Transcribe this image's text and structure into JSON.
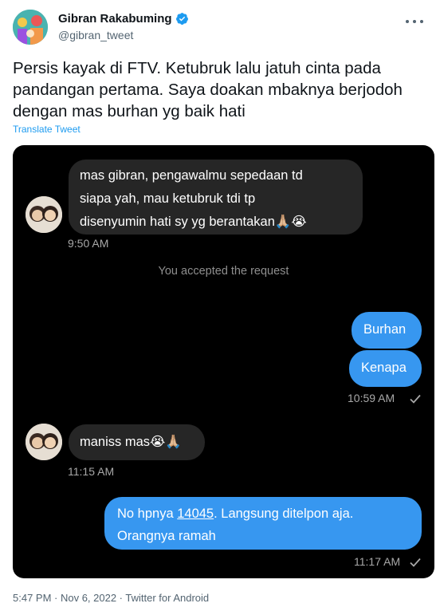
{
  "tweet": {
    "author_name": "Gibran Rakabuming",
    "author_handle": "@gibran_tweet",
    "verified_icon": "verified-badge-icon",
    "more_icon": "more-options-icon",
    "text": "Persis kayak di FTV. Ketubruk lalu jatuh cinta pada pandangan pertama. Saya doakan mbaknya berjodoh dengan mas burhan yg baik hati",
    "translate_label": "Translate Tweet",
    "footer": "5:47 PM · Nov 6, 2022 · Twitter for Android"
  },
  "chat": {
    "messages": [
      {
        "direction": "incoming",
        "lines": [
          "mas gibran, pengawalmu sepedaan td",
          "siapa yah, mau ketubruk tdi tp",
          "disenyumin hati sy yg berantakan🙏🏼😭"
        ],
        "time": "9:50 AM"
      },
      {
        "system": "You accepted the request"
      },
      {
        "direction": "outgoing",
        "lines": [
          "Burhan"
        ]
      },
      {
        "direction": "outgoing",
        "lines": [
          "Kenapa"
        ],
        "time": "10:59 AM"
      },
      {
        "direction": "incoming",
        "lines": [
          "maniss mas😭🙏🏼"
        ],
        "time": "11:15 AM"
      },
      {
        "direction": "outgoing",
        "prefix": "No hpnya ",
        "number": "14045",
        "suffix": ". Langsung ditelpon aja.",
        "line2": "Orangnya ramah",
        "time": "11:17 AM"
      }
    ],
    "colors": {
      "background": "#000000",
      "incoming_bubble": "#262626",
      "outgoing_bubble": "#3797f0",
      "accent": "#1d9bf0"
    }
  }
}
